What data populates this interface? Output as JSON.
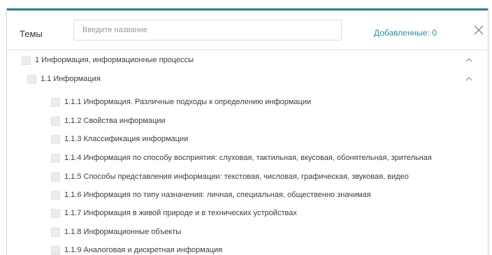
{
  "header": {
    "title": "Темы",
    "search_placeholder": "Введите название",
    "added_label": "Добавленные: 0"
  },
  "icons": {
    "close": "close-icon",
    "expand": "chevron-up-icon"
  },
  "colors": {
    "accent": "#2a7f8e",
    "link": "#2a8fa1",
    "checkbox": "#ececec"
  },
  "tree": {
    "topic": "1 Информация, информационные процессы",
    "subtopic": "1.1 Информация",
    "items": [
      "1.1.1 Информация. Различные подходы к определению информации",
      "1.1.2 Свойства информации",
      "1.1.3 Классификация информации",
      "1.1.4 Информация по способу восприятия: слуховая, тактильная, вкусовая, обонятельная, зрительная",
      "1.1.5 Способы представления информации: текстовая, числовая, графическая, звуковая, видео",
      "1.1.6 Информация по типу назначения: личная, специальная, общественно значимая",
      "1.1.7 Информация в живой природе и в технических устройствах",
      "1.1.8 Информационные объекты",
      "1.1.9 Аналоговая и дискретная информация"
    ]
  }
}
